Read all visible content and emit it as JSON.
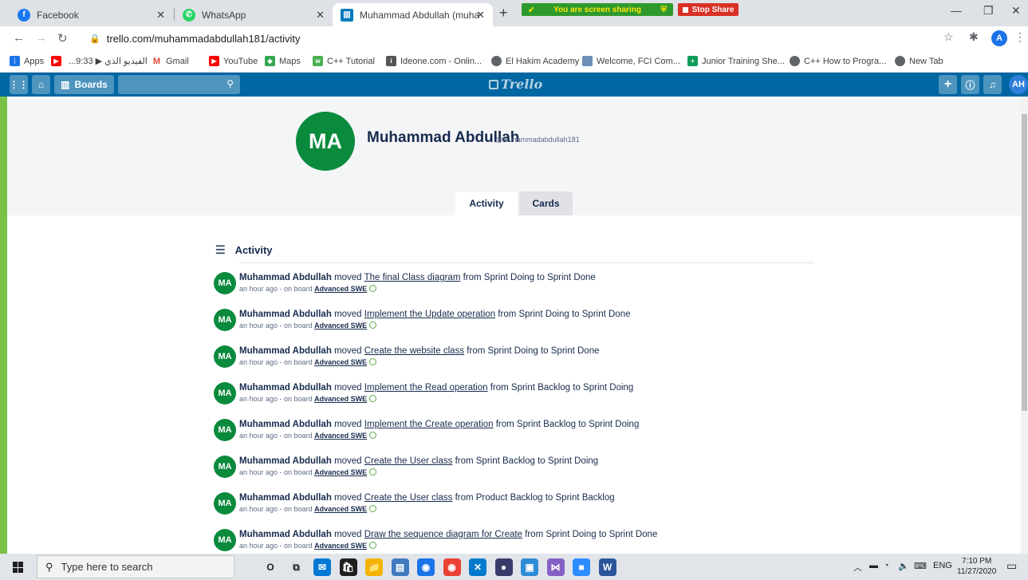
{
  "browser": {
    "tabs": [
      {
        "title": "Facebook",
        "icon": "facebook-icon",
        "color": "#1877f2"
      },
      {
        "title": "WhatsApp",
        "icon": "whatsapp-icon",
        "color": "#25d366"
      },
      {
        "title": "Muhammad Abdullah (muhamm",
        "icon": "trello-icon",
        "color": "#0079bf"
      }
    ],
    "screen_share_text": "You are screen sharing",
    "stop_share_label": "Stop Share",
    "url": "trello.com/muhammadabdullah181/activity",
    "profile_initial": "A"
  },
  "bookmarks": [
    {
      "label": "Apps",
      "icon": "apps-grid-icon",
      "color": "#1a73e8"
    },
    {
      "label": "",
      "icon": "youtube-icon",
      "color": "#ff0000"
    },
    {
      "label": "...9:33 ▶ الفيديو الذي",
      "icon": "video-icon",
      "color": "#ffffff"
    },
    {
      "label": "Gmail",
      "icon": "gmail-icon",
      "color": "#ea4335"
    },
    {
      "label": "YouTube",
      "icon": "youtube-icon",
      "color": "#ff0000"
    },
    {
      "label": "Maps",
      "icon": "maps-icon",
      "color": "#34a853"
    },
    {
      "label": "C++ Tutorial",
      "icon": "w3schools-icon",
      "color": "#4caf50"
    },
    {
      "label": "Ideone.com - Onlin...",
      "icon": "ideone-icon",
      "color": "#555555"
    },
    {
      "label": "El Hakim Academy",
      "icon": "globe-icon",
      "color": "#5f6368"
    },
    {
      "label": "Welcome, FCI Com...",
      "icon": "fci-icon",
      "color": "#6b8fb5"
    },
    {
      "label": "Junior Training She...",
      "icon": "sheets-icon",
      "color": "#0f9d58"
    },
    {
      "label": "C++ How to Progra...",
      "icon": "globe-icon",
      "color": "#5f6368"
    },
    {
      "label": "New Tab",
      "icon": "globe-icon",
      "color": "#5f6368"
    }
  ],
  "trello": {
    "boards_label": "Boards",
    "logo_text": "Trello",
    "user_initials": "AH",
    "colors": {
      "header": "#0067a3",
      "avatar": "#0a8a3c"
    }
  },
  "profile": {
    "initials": "MA",
    "name": "Muhammad Abdullah",
    "username": "@muhammadabdullah181",
    "tabs": [
      "Activity",
      "Cards"
    ],
    "active_tab": "Activity"
  },
  "activity": {
    "heading": "Activity",
    "items": [
      {
        "who": "Muhammad Abdullah",
        "verb": "moved",
        "card": "The final Class diagram",
        "from": "Sprint Doing",
        "to": "Sprint Done",
        "time": "an hour ago - on board",
        "board": "Advanced SWE"
      },
      {
        "who": "Muhammad Abdullah",
        "verb": "moved",
        "card": "Implement the Update operation",
        "from": "Sprint Doing",
        "to": "Sprint Done",
        "time": "an hour ago - on board",
        "board": "Advanced SWE"
      },
      {
        "who": "Muhammad Abdullah",
        "verb": "moved",
        "card": "Create the website class",
        "from": "Sprint Doing",
        "to": "Sprint Done",
        "time": "an hour ago - on board",
        "board": "Advanced SWE"
      },
      {
        "who": "Muhammad Abdullah",
        "verb": "moved",
        "card": "Implement the Read operation",
        "from": "Sprint Backlog",
        "to": "Sprint Doing",
        "time": "an hour ago - on board",
        "board": "Advanced SWE"
      },
      {
        "who": "Muhammad Abdullah",
        "verb": "moved",
        "card": "Implement the Create operation",
        "from": "Sprint Backlog",
        "to": "Sprint Doing",
        "time": "an hour ago - on board",
        "board": "Advanced SWE"
      },
      {
        "who": "Muhammad Abdullah",
        "verb": "moved",
        "card": "Create the User class",
        "from": "Sprint Backlog",
        "to": "Sprint Doing",
        "time": "an hour ago - on board",
        "board": "Advanced SWE"
      },
      {
        "who": "Muhammad Abdullah",
        "verb": "moved",
        "card": "Create the User class",
        "from": "Product Backlog",
        "to": "Sprint Backlog",
        "time": "an hour ago - on board",
        "board": "Advanced SWE"
      },
      {
        "who": "Muhammad Abdullah",
        "verb": "moved",
        "card": "Draw the sequence diagram for Create",
        "from": "Sprint Doing",
        "to": "Sprint Done",
        "time": "an hour ago - on board",
        "board": "Advanced SWE"
      }
    ]
  },
  "taskbar": {
    "search_placeholder": "Type here to search",
    "apps": [
      {
        "icon": "cortana-icon",
        "color": "#1f1f1f"
      },
      {
        "icon": "task-view-icon",
        "color": "#1f1f1f"
      },
      {
        "icon": "mail-icon",
        "color": "#0078d4"
      },
      {
        "icon": "store-icon",
        "color": "#1f1f1f"
      },
      {
        "icon": "file-explorer-icon",
        "color": "#f2b400"
      },
      {
        "icon": "stickies-icon",
        "color": "#3f7ac1"
      },
      {
        "icon": "chrome-icon",
        "color": "#1a73e8"
      },
      {
        "icon": "chrome-profile-icon",
        "color": "#e94235"
      },
      {
        "icon": "vscode-icon",
        "color": "#007acc"
      },
      {
        "icon": "record-icon",
        "color": "#3b3b6b"
      },
      {
        "icon": "photos-icon",
        "color": "#2d8cd6"
      },
      {
        "icon": "visual-studio-icon",
        "color": "#865fc5"
      },
      {
        "icon": "zoom-icon",
        "color": "#2d8cff"
      },
      {
        "icon": "word-icon",
        "color": "#2b579a"
      }
    ],
    "language": "ENG",
    "time": "7:10 PM",
    "date": "11/27/2020"
  }
}
